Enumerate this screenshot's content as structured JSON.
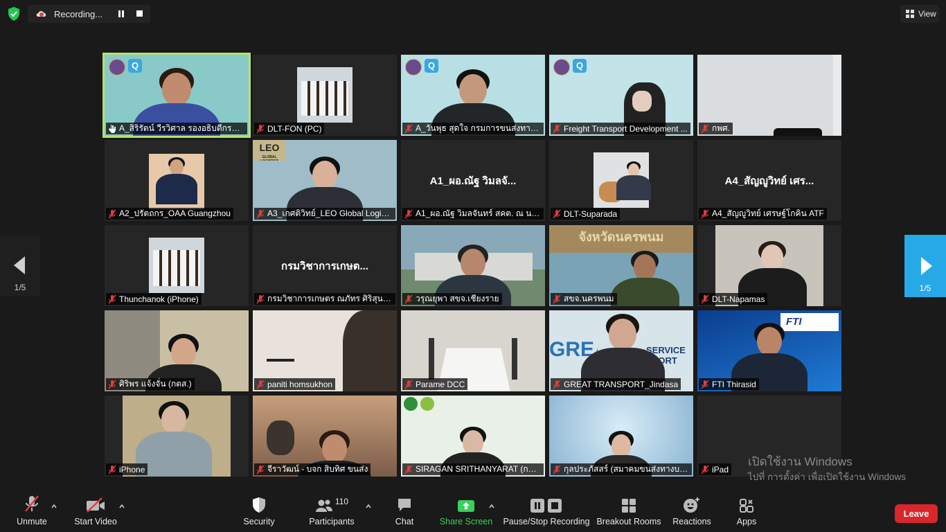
{
  "recording": {
    "text": "Recording..."
  },
  "view_button": {
    "label": "View"
  },
  "participants_tiles": [
    {
      "name": "A_สิริรัตน์ วีรวิศาล รองอธิบดีกรมการ...",
      "big": ""
    },
    {
      "name": "DLT-FON (PC)",
      "big": ""
    },
    {
      "name": "A_วันพุธ สุดใจ กรมการขนส่งทางบก",
      "big": ""
    },
    {
      "name": "Freight Transport Development ...",
      "big": ""
    },
    {
      "name": "กพศ.",
      "big": ""
    },
    {
      "name": "A2_ปรัตถกร_OAA Guangzhou",
      "big": ""
    },
    {
      "name": "A3_เกศติวิทย์_LEO Global Logist...",
      "big": ""
    },
    {
      "name": "A1_ผอ.ณัฐ วิมลจันทร์ สคต. ณ นค...",
      "big": "A1_ผอ.ณัฐ วิมลจั..."
    },
    {
      "name": "DLT-Suparada",
      "big": ""
    },
    {
      "name": "A4_สัญญูวิทย์ เศรษฐ์โกคิน ATF",
      "big": "A4_สัญญูวิทย์ เศร..."
    },
    {
      "name": "Thunchanok (iPhone)",
      "big": ""
    },
    {
      "name": "กรมวิชาการเกษตร ณภัทร ศิริสุนท...",
      "big": "กรมวิชาการเกษต..."
    },
    {
      "name": "วรุณยุพา สขจ.เชียงราย",
      "big": ""
    },
    {
      "name": "สขจ.นครพนม",
      "big": ""
    },
    {
      "name": "DLT-Napamas",
      "big": ""
    },
    {
      "name": "ศิริพร แจ้งจั่น (กตส.)",
      "big": ""
    },
    {
      "name": "paniti homsukhon",
      "big": ""
    },
    {
      "name": "Parame DCC",
      "big": ""
    },
    {
      "name": "GREAT TRANSPORT_Jindasa",
      "big": ""
    },
    {
      "name": "FTI Thirasid",
      "big": ""
    },
    {
      "name": "iPhone",
      "big": ""
    },
    {
      "name": "จีราวัฒน์ - บจก สิบทิศ ขนส่ง",
      "big": ""
    },
    {
      "name": "SIRAGAN SRITHANYARAT (กรม...",
      "big": ""
    },
    {
      "name": "กุลประภัสสร์ (สมาคมขนส่งทางบกนา...",
      "big": ""
    },
    {
      "name": "iPad",
      "big": ""
    }
  ],
  "tile_text": {
    "leo": "LEO",
    "leo_sub": "GLOBAL LOGISTICS",
    "fti": "FTI",
    "great": "GREAT",
    "service": "SERVICE",
    "port": "SPORT",
    "city_sign": "จังหวัดนครพนม"
  },
  "paging": {
    "left": "1/5",
    "right": "1/5"
  },
  "watermark": {
    "line1": "เปิดใช้งาน Windows",
    "line2": "ไปที่ การตั้งค่า เพื่อเปิดใช้งาน Windows"
  },
  "toolbar": {
    "unmute": "Unmute",
    "start_video": "Start Video",
    "security": "Security",
    "participants": "Participants",
    "participants_count": "110",
    "chat": "Chat",
    "share_screen": "Share Screen",
    "pause_stop": "Pause/Stop Recording",
    "breakout": "Breakout Rooms",
    "reactions": "Reactions",
    "apps": "Apps",
    "leave": "Leave"
  },
  "colors": {
    "active_speaker": "#b5e26b",
    "share_green": "#38d159",
    "leave_red": "#d9262b",
    "nav_blue": "#27a9e7"
  }
}
